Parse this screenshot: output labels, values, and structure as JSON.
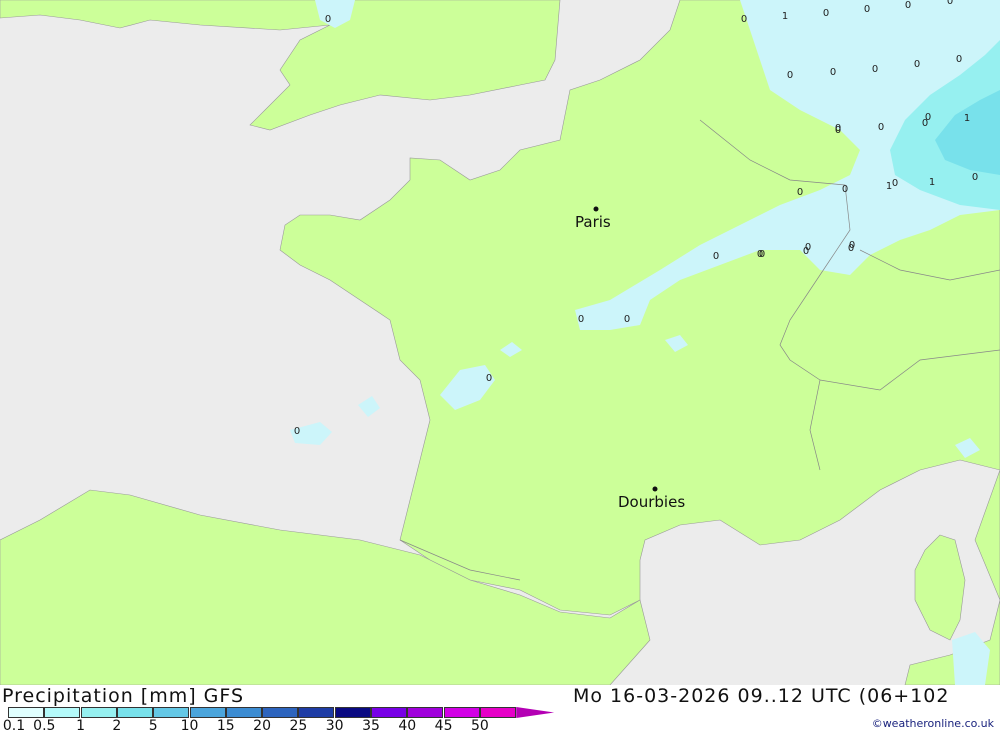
{
  "title": {
    "left": "Precipitation [mm] GFS",
    "right": "Mo 16-03-2026 09..12 UTC (06+102"
  },
  "cities": [
    {
      "name": "Paris"
    },
    {
      "name": "Dourbies"
    }
  ],
  "grid_values": [
    "0",
    "0",
    "1",
    "0",
    "0",
    "0",
    "0",
    "0",
    "0",
    "0",
    "0",
    "0",
    "0",
    "0",
    "0",
    "1",
    "0",
    "0",
    "1",
    "1",
    "0",
    "0",
    "0",
    "0",
    "0",
    "0",
    "0",
    "0",
    "0",
    "0",
    "0",
    "0",
    "0",
    "0",
    "0"
  ],
  "legend": {
    "ticks": [
      "0.1",
      "0.5",
      "1",
      "2",
      "5",
      "10",
      "15",
      "20",
      "25",
      "30",
      "35",
      "40",
      "45",
      "50"
    ],
    "colors": [
      "#e0ffff",
      "#b4fafa",
      "#96f0f0",
      "#78e1eb",
      "#64c8e6",
      "#4ba5dc",
      "#3c8cd2",
      "#2d64be",
      "#1e3ca5",
      "#0a0a82",
      "#7800e6",
      "#a000dc",
      "#d200e6",
      "#e600c8",
      "#b400b4"
    ]
  },
  "credit": "©weatheronline.co.uk",
  "colors": {
    "land": "#ccff99",
    "sea": "#ececec",
    "precip_light": "#ccf5fa",
    "precip_mid": "#96f0f0",
    "precip_high": "#78e1eb"
  }
}
